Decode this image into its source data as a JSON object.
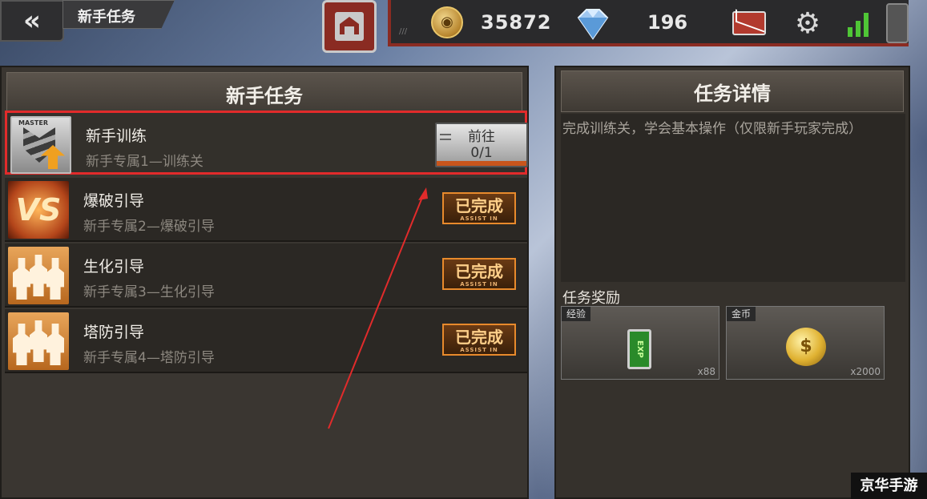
{
  "header": {
    "back_icon": "double-chevron-left",
    "title": "新手任务",
    "home_icon": "home",
    "coins": "35872",
    "gems": "196",
    "icons": [
      "coin-icon",
      "diamond-icon",
      "mail-icon",
      "gear-icon",
      "signal-icon"
    ]
  },
  "task_panel": {
    "title": "新手任务",
    "tasks": [
      {
        "name": "新手训练",
        "desc": "新手专属1—训练关",
        "icon": "master-rank-up",
        "status": "go",
        "button_label": "前往",
        "progress": "0/1"
      },
      {
        "name": "爆破引导",
        "desc": "新手专属2—爆破引导",
        "icon": "vs",
        "status": "done",
        "badge_label": "已完成",
        "badge_sub": "ASSIST IN",
        "vs_text": "VS"
      },
      {
        "name": "生化引导",
        "desc": "新手专属3—生化引导",
        "icon": "squad",
        "status": "done",
        "badge_label": "已完成",
        "badge_sub": "ASSIST IN"
      },
      {
        "name": "塔防引导",
        "desc": "新手专属4—塔防引导",
        "icon": "squad",
        "status": "done",
        "badge_label": "已完成",
        "badge_sub": "ASSIST IN"
      }
    ],
    "master_tag": "MASTER"
  },
  "detail_panel": {
    "title": "任务详情",
    "description": "完成训练关，学会基本操作（仅限新手玩家完成）",
    "rewards_title": "任务奖励",
    "rewards": [
      {
        "label": "经验",
        "count": "x88",
        "icon": "exp-card",
        "icon_text": "EXP"
      },
      {
        "label": "金币",
        "count": "x2000",
        "icon": "gold-coins",
        "icon_text": "$"
      }
    ]
  },
  "annotation": {
    "color": "#e12b2b"
  },
  "watermark": "京华手游"
}
